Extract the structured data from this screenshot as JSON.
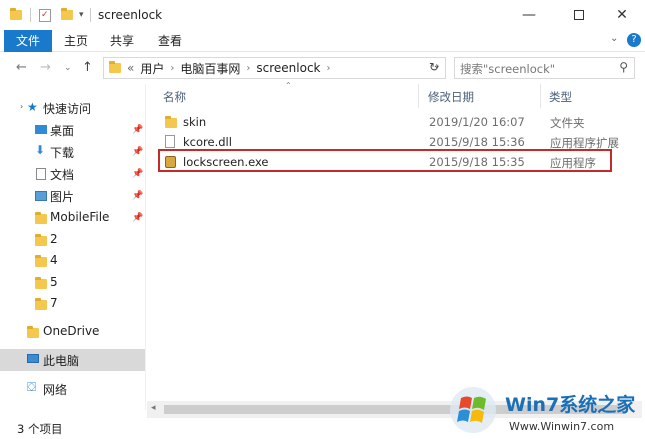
{
  "window": {
    "title": "screenlock"
  },
  "ribbon": {
    "tabs": [
      "文件",
      "主页",
      "共享",
      "查看"
    ]
  },
  "address": {
    "crumbs": [
      "«",
      "用户",
      "电脑百事网",
      "screenlock"
    ],
    "search_placeholder": "搜索\"screenlock\""
  },
  "sidebar": {
    "quick_access": "快速访问",
    "items": [
      {
        "label": "桌面",
        "pinned": true
      },
      {
        "label": "下载",
        "pinned": true
      },
      {
        "label": "文档",
        "pinned": true
      },
      {
        "label": "图片",
        "pinned": true
      },
      {
        "label": "MobileFile",
        "pinned": true
      },
      {
        "label": "2"
      },
      {
        "label": "4"
      },
      {
        "label": "5"
      },
      {
        "label": "7"
      }
    ],
    "onedrive": "OneDrive",
    "this_pc": "此电脑",
    "network": "网络"
  },
  "columns": {
    "name": "名称",
    "date": "修改日期",
    "type": "类型"
  },
  "files": [
    {
      "name": "skin",
      "date": "2019/1/20 16:07",
      "type": "文件夹",
      "icon": "folder-icon"
    },
    {
      "name": "kcore.dll",
      "date": "2015/9/18 15:36",
      "type": "应用程序扩展",
      "icon": "dll-file-icon"
    },
    {
      "name": "lockscreen.exe",
      "date": "2015/9/18 15:35",
      "type": "应用程序",
      "icon": "lock-app-icon"
    }
  ],
  "status": {
    "count": "3 个项目"
  },
  "watermark": {
    "brand": "Win7系统之家",
    "url": "Www.Winwin7.com"
  },
  "colors": {
    "accent": "#1979ca",
    "highlight": "#c32a2a",
    "folder": "#f4c84e"
  }
}
